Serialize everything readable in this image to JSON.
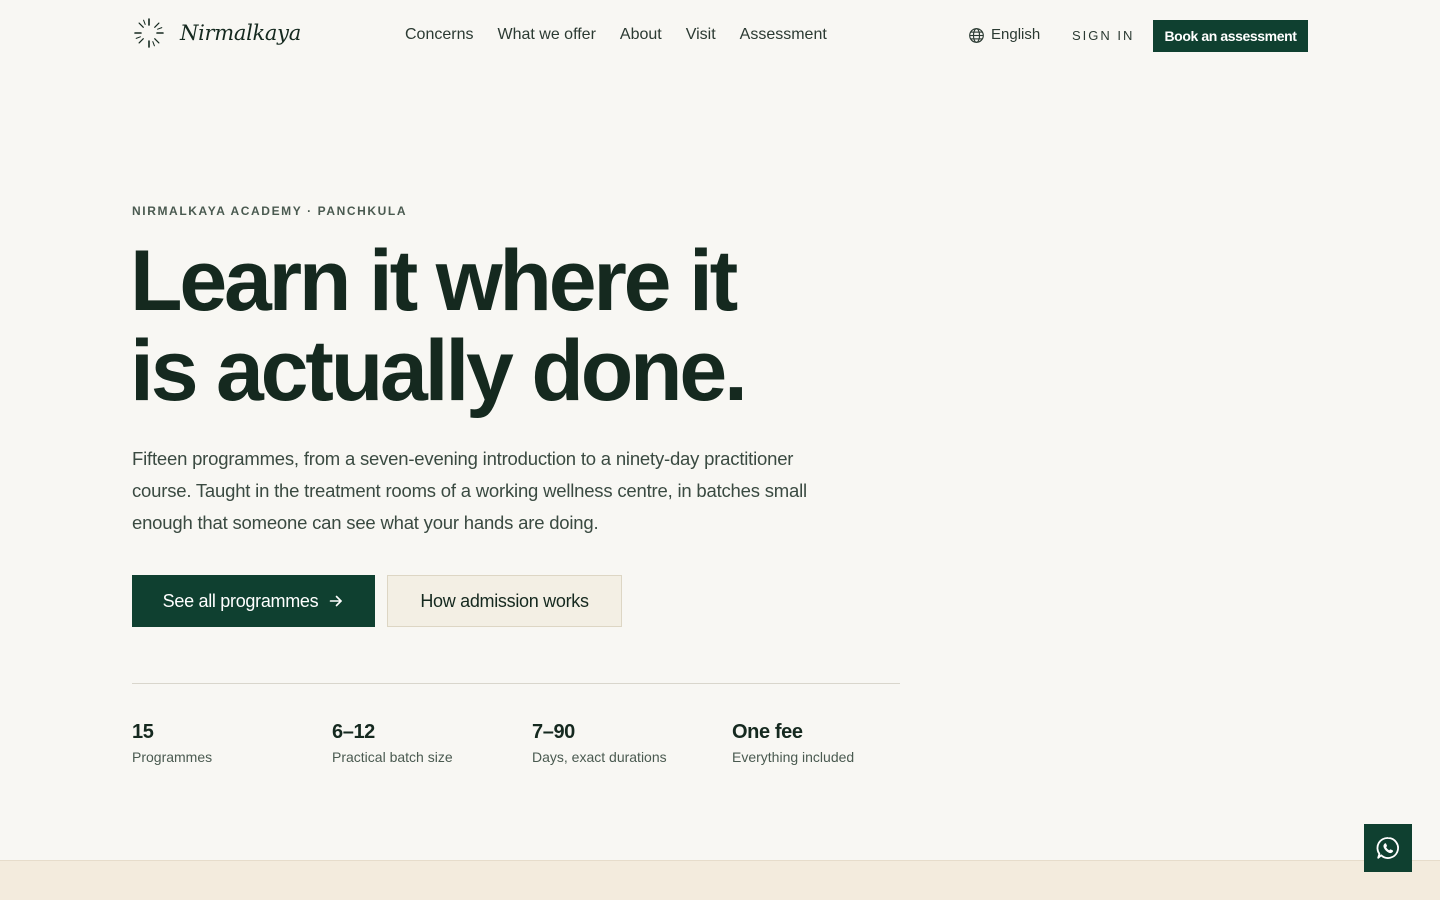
{
  "brand": {
    "name": "Nirmalkaya",
    "logo_icon": "sunburst-mark-icon"
  },
  "nav": {
    "items": [
      {
        "label": "Concerns"
      },
      {
        "label": "What we offer"
      },
      {
        "label": "About"
      },
      {
        "label": "Visit"
      },
      {
        "label": "Assessment"
      }
    ]
  },
  "header": {
    "language": "English",
    "language_icon": "globe-icon",
    "sign_in": "SIGN IN",
    "cta": "Book an assessment"
  },
  "hero": {
    "eyebrow": "NIRMALKAYA ACADEMY · PANCHKULA",
    "headline_line1": "Learn it where it",
    "headline_line2": "is actually done.",
    "lede": "Fifteen programmes, from a seven-evening introduction to a ninety-day practitioner course. Taught in the treatment rooms of a working wellness centre, in batches small enough that someone can see what your hands are doing.",
    "primary_button": "See all programmes",
    "secondary_button": "How admission works"
  },
  "stats": [
    {
      "value": "15",
      "label": "Programmes"
    },
    {
      "value": "6–12",
      "label": "Practical batch size"
    },
    {
      "value": "7–90",
      "label": "Days, exact durations"
    },
    {
      "value": "One fee",
      "label": "Everything included"
    }
  ],
  "floating": {
    "icon": "whatsapp-icon"
  },
  "colors": {
    "background": "#f8f7f3",
    "primary": "#0f4030",
    "text": "#15291f",
    "secondary_bg": "#f3efe4",
    "band": "#f3ebdd"
  }
}
